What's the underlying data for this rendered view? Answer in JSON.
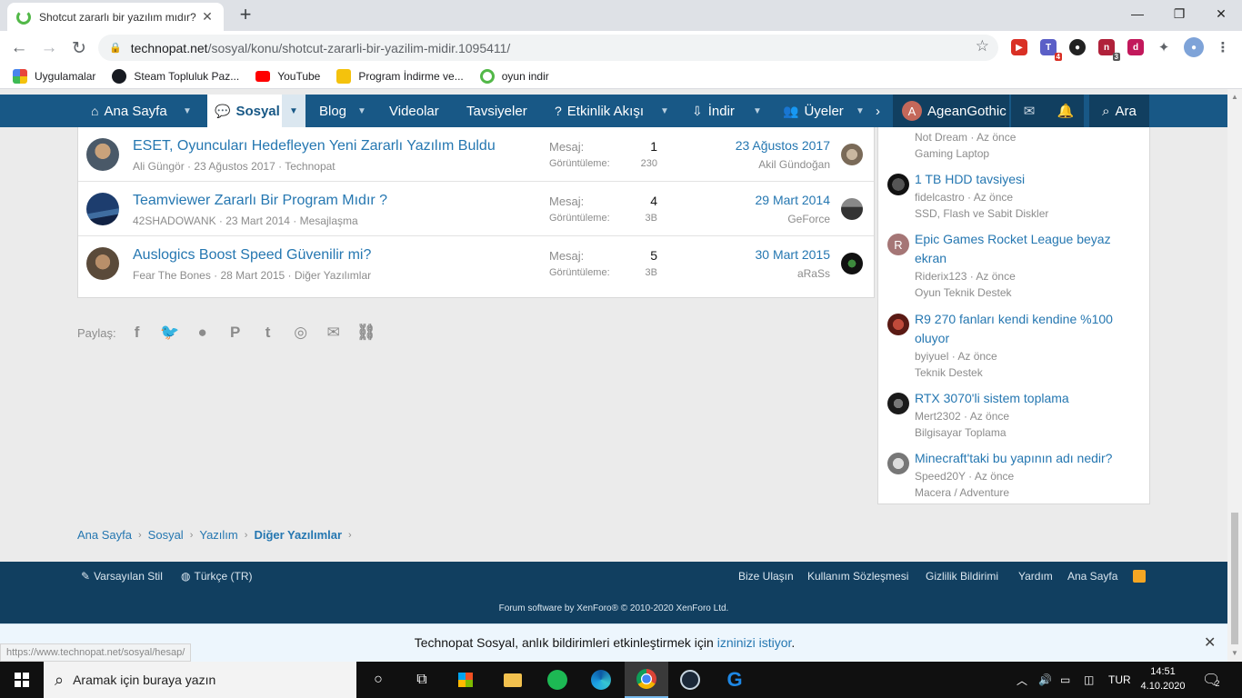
{
  "browser": {
    "tab_title": "Shotcut zararlı bir yazılım mıdır?",
    "url_domain": "technopat.net",
    "url_path": "/sosyal/konu/shotcut-zararli-bir-yazilim-midir.1095411/",
    "bookmarks": [
      {
        "label": "Uygulamalar",
        "color": "#e8453c"
      },
      {
        "label": "Steam Topluluk Paz...",
        "color": "#171a21"
      },
      {
        "label": "YouTube",
        "color": "#ff0000"
      },
      {
        "label": "Program İndirme ve...",
        "color": "#f4c20d"
      },
      {
        "label": "oyun indir",
        "color": "#52b848"
      }
    ],
    "ext_badges": {
      "teams": "4",
      "notion": "3"
    }
  },
  "site_nav": {
    "home": "Ana Sayfa",
    "social": "Sosyal",
    "blog": "Blog",
    "videos": "Videolar",
    "tips": "Tavsiyeler",
    "activity": "Etkinlik Akışı",
    "download": "İndir",
    "members": "Üyeler",
    "user_initial": "A",
    "username": "AgeanGothic",
    "search": "Ara"
  },
  "threads": [
    {
      "title": "ESET, Oyuncuları Hedefleyen Yeni Zararlı Yazılım Buldu",
      "author": "Ali Güngör",
      "date": "23 Ağustos 2017",
      "forum": "Technopat",
      "replies_label": "Mesaj:",
      "replies": "1",
      "views_label": "Görüntüleme:",
      "views": "230",
      "last_date": "23 Ağustos 2017",
      "last_user": "Akil Gündoğan"
    },
    {
      "title": "Teamviewer Zararlı Bir Program Mıdır ?",
      "author": "42SHADOWANK",
      "date": "23 Mart 2014",
      "forum": "Mesajlaşma",
      "replies_label": "Mesaj:",
      "replies": "4",
      "views_label": "Görüntüleme:",
      "views": "3B",
      "last_date": "29 Mart 2014",
      "last_user": "GeForce"
    },
    {
      "title": "Auslogics Boost Speed Güvenilir mi?",
      "author": "Fear The Bones",
      "date": "28 Mart 2015",
      "forum": "Diğer Yazılımlar",
      "replies_label": "Mesaj:",
      "replies": "5",
      "views_label": "Görüntüleme:",
      "views": "3B",
      "last_date": "30 Mart 2015",
      "last_user": "aRaSs"
    }
  ],
  "share_label": "Paylaş:",
  "sidebar": [
    {
      "title": "",
      "user": "Not Dream",
      "time": "Az önce",
      "forum": "Gaming Laptop"
    },
    {
      "title": "1 TB HDD tavsiyesi",
      "user": "fidelcastro",
      "time": "Az önce",
      "forum": "SSD, Flash ve Sabit Diskler"
    },
    {
      "title": "Epic Games Rocket League beyaz ekran",
      "user": "Riderix123",
      "time": "Az önce",
      "forum": "Oyun Teknik Destek",
      "avatar_letter": "R"
    },
    {
      "title": "R9 270 fanları kendi kendine %100 oluyor",
      "user": "byiyuel",
      "time": "Az önce",
      "forum": "Teknik Destek"
    },
    {
      "title": "RTX 3070'li sistem toplama",
      "user": "Mert2302",
      "time": "Az önce",
      "forum": "Bilgisayar Toplama"
    },
    {
      "title": "Minecraft'taki bu yapının adı nedir?",
      "user": "Speed20Y",
      "time": "Az önce",
      "forum": "Macera / Adventure"
    }
  ],
  "breadcrumbs": [
    "Ana Sayfa",
    "Sosyal",
    "Yazılım",
    "Diğer Yazılımlar"
  ],
  "footer": {
    "style": "Varsayılan Stil",
    "language": "Türkçe (TR)",
    "links": [
      "Bize Ulaşın",
      "Kullanım Sözleşmesi",
      "Gizlilik Bildirimi",
      "Yardım",
      "Ana Sayfa"
    ],
    "copyright": "Forum software by XenForo® © 2010-2020 XenForo Ltd."
  },
  "notification": {
    "text": "Technopat Sosyal, anlık bildirimleri etkinleştirmek için",
    "link": "izninizi istiyor",
    "suffix": "."
  },
  "status_url": "https://www.technopat.net/sosyal/hesap/",
  "taskbar": {
    "search_placeholder": "Aramak için buraya yazın",
    "lang": "TUR",
    "time": "14:51",
    "date": "4.10.2020",
    "notif_count": "2"
  }
}
